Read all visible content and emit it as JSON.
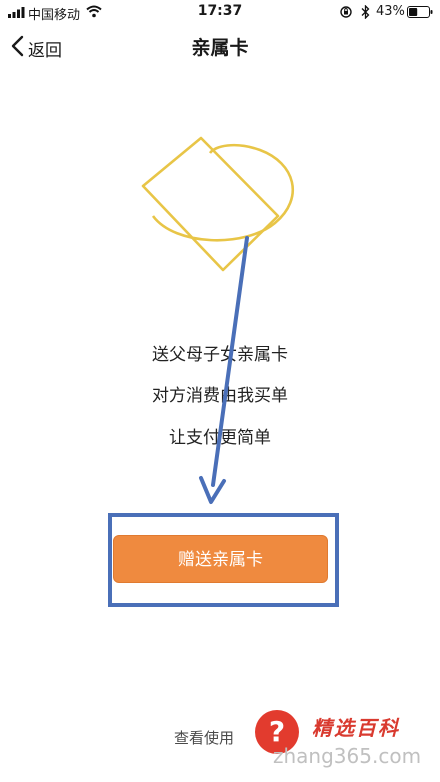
{
  "status_bar": {
    "carrier": "中国移动",
    "time": "17:37",
    "battery_percent": "43%",
    "battery_level": 0.43,
    "icons": [
      "signal-icon",
      "wifi-icon",
      "rotation-lock-icon",
      "bluetooth-icon",
      "battery-icon"
    ]
  },
  "nav": {
    "back_label": "返回",
    "title": "亲属卡"
  },
  "slogan": {
    "line1": "送父母子女亲属卡",
    "line2": "对方消费由我买单",
    "line3": "让支付更简单"
  },
  "primary_button": {
    "label": "赠送亲属卡"
  },
  "footer": {
    "view_usage": "查看使用"
  },
  "watermark": {
    "title": "精选百科",
    "url": "zhang365.com",
    "badge": "?"
  },
  "colors": {
    "button": "#ef8a3f",
    "illustration": "#e8c547",
    "annotation": "#4a6fb8",
    "watermark_red": "#e23b2e"
  }
}
